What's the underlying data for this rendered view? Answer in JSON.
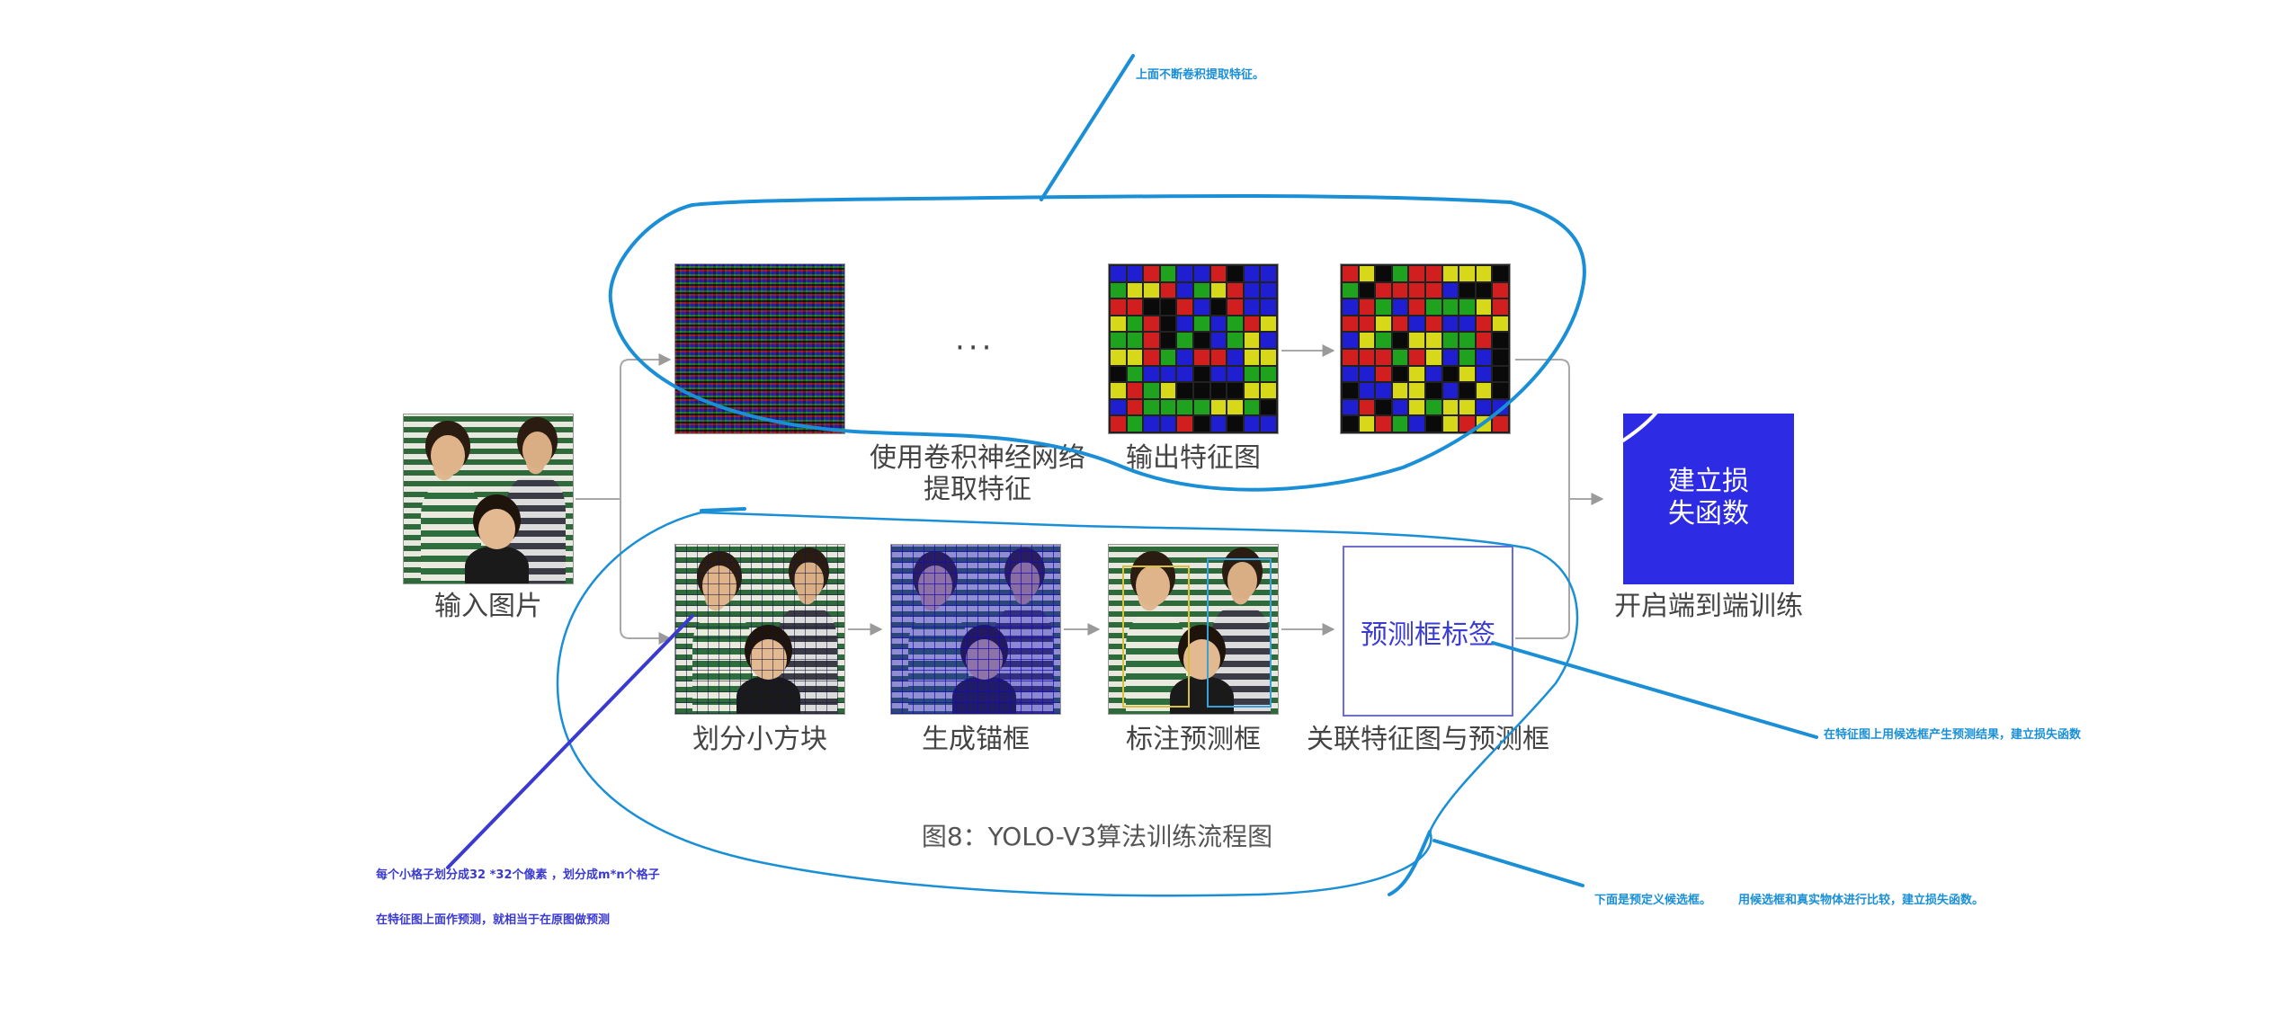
{
  "diagram": {
    "top_row": {
      "ellipsis": "···",
      "cnn_label": "使用卷积神经网络提取特征",
      "cnn_label_line1": "使用卷积神经网络",
      "cnn_label_line2": "提取特征",
      "output_label": "输出特征图"
    },
    "input_label": "输入图片",
    "bottom_row": {
      "grid_label": "划分小方块",
      "anchor_label": "生成锚框",
      "annotate_label": "标注预测框",
      "pred_box_text": "预测框标签",
      "associate_label": "关联特征图与预测框"
    },
    "loss_box": {
      "line1": "建立损",
      "line2": "失函数"
    },
    "loss_label": "开启端到端训练",
    "caption": "图8：YOLO-V3算法训练流程图"
  },
  "annotations": {
    "top_note": "上面不断卷积提取特征。",
    "right_note": "在特征图上用候选框产生预测结果，建立损失函数",
    "bottom_right_note_a": "下面是预定义候选框。",
    "bottom_right_note_b": "用候选框和真实物体进行比较，建立损失函数。",
    "left_note_1": "每个小格子划分成32 *32个像素 ，划分成m*n个格子",
    "left_note_2": "在特征图上面作预测，就相当于在原图做预测"
  },
  "colors": {
    "annotation_cyan": "#1a8fd6",
    "annotation_blue": "#3a3ad0",
    "loss_box_fill": "#2d2be4",
    "pred_box_border": "#6a6aee",
    "arrow_gray": "#9a9a9a"
  }
}
